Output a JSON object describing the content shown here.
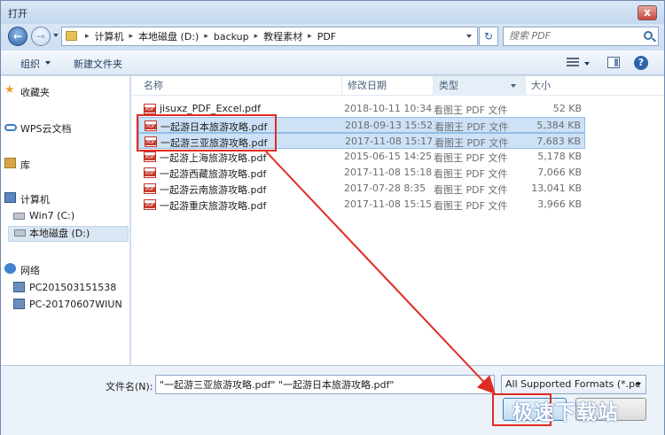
{
  "window": {
    "title": "打开",
    "close_label": "x"
  },
  "address": {
    "crumbs": [
      "计算机",
      "本地磁盘 (D:)",
      "backup",
      "教程素材",
      "PDF"
    ],
    "search_placeholder": "搜索 PDF"
  },
  "toolbar": {
    "organize": "组织",
    "new_folder": "新建文件夹"
  },
  "nav": {
    "favorites": "收藏夹",
    "wps_cloud": "WPS云文档",
    "library": "库",
    "computer": "计算机",
    "drive_c": "Win7 (C:)",
    "drive_d": "本地磁盘 (D:)",
    "network": "网络",
    "pc1": "PC201503151538",
    "pc2": "PC-20170607WIUN"
  },
  "columns": {
    "name": "名称",
    "date": "修改日期",
    "type": "类型",
    "size": "大小"
  },
  "files": [
    {
      "name": "jisuxz_PDF_Excel.pdf",
      "date": "2018-10-11 10:34",
      "type": "看图王 PDF 文件",
      "size": "52 KB"
    },
    {
      "name": "一起游日本旅游攻略.pdf",
      "date": "2018-09-13 15:52",
      "type": "看图王 PDF 文件",
      "size": "5,384 KB"
    },
    {
      "name": "一起游三亚旅游攻略.pdf",
      "date": "2017-11-08 15:17",
      "type": "看图王 PDF 文件",
      "size": "7,683 KB"
    },
    {
      "name": "一起游上海旅游攻略.pdf",
      "date": "2015-06-15 14:25",
      "type": "看图王 PDF 文件",
      "size": "5,178 KB"
    },
    {
      "name": "一起游西藏旅游攻略.pdf",
      "date": "2017-11-08 15:18",
      "type": "看图王 PDF 文件",
      "size": "7,066 KB"
    },
    {
      "name": "一起游云南旅游攻略.pdf",
      "date": "2017-07-28 8:35",
      "type": "看图王 PDF 文件",
      "size": "13,041 KB"
    },
    {
      "name": "一起游重庆旅游攻略.pdf",
      "date": "2017-11-08 15:15",
      "type": "看图王 PDF 文件",
      "size": "3,966 KB"
    }
  ],
  "bottom": {
    "filename_label": "文件名(N):",
    "filename_value": "\"一起游三亚旅游攻略.pdf\" \"一起游日本旅游攻略.pdf\"",
    "filter": "All Supported Formats (*.pc"
  },
  "watermark": "极速下载站"
}
